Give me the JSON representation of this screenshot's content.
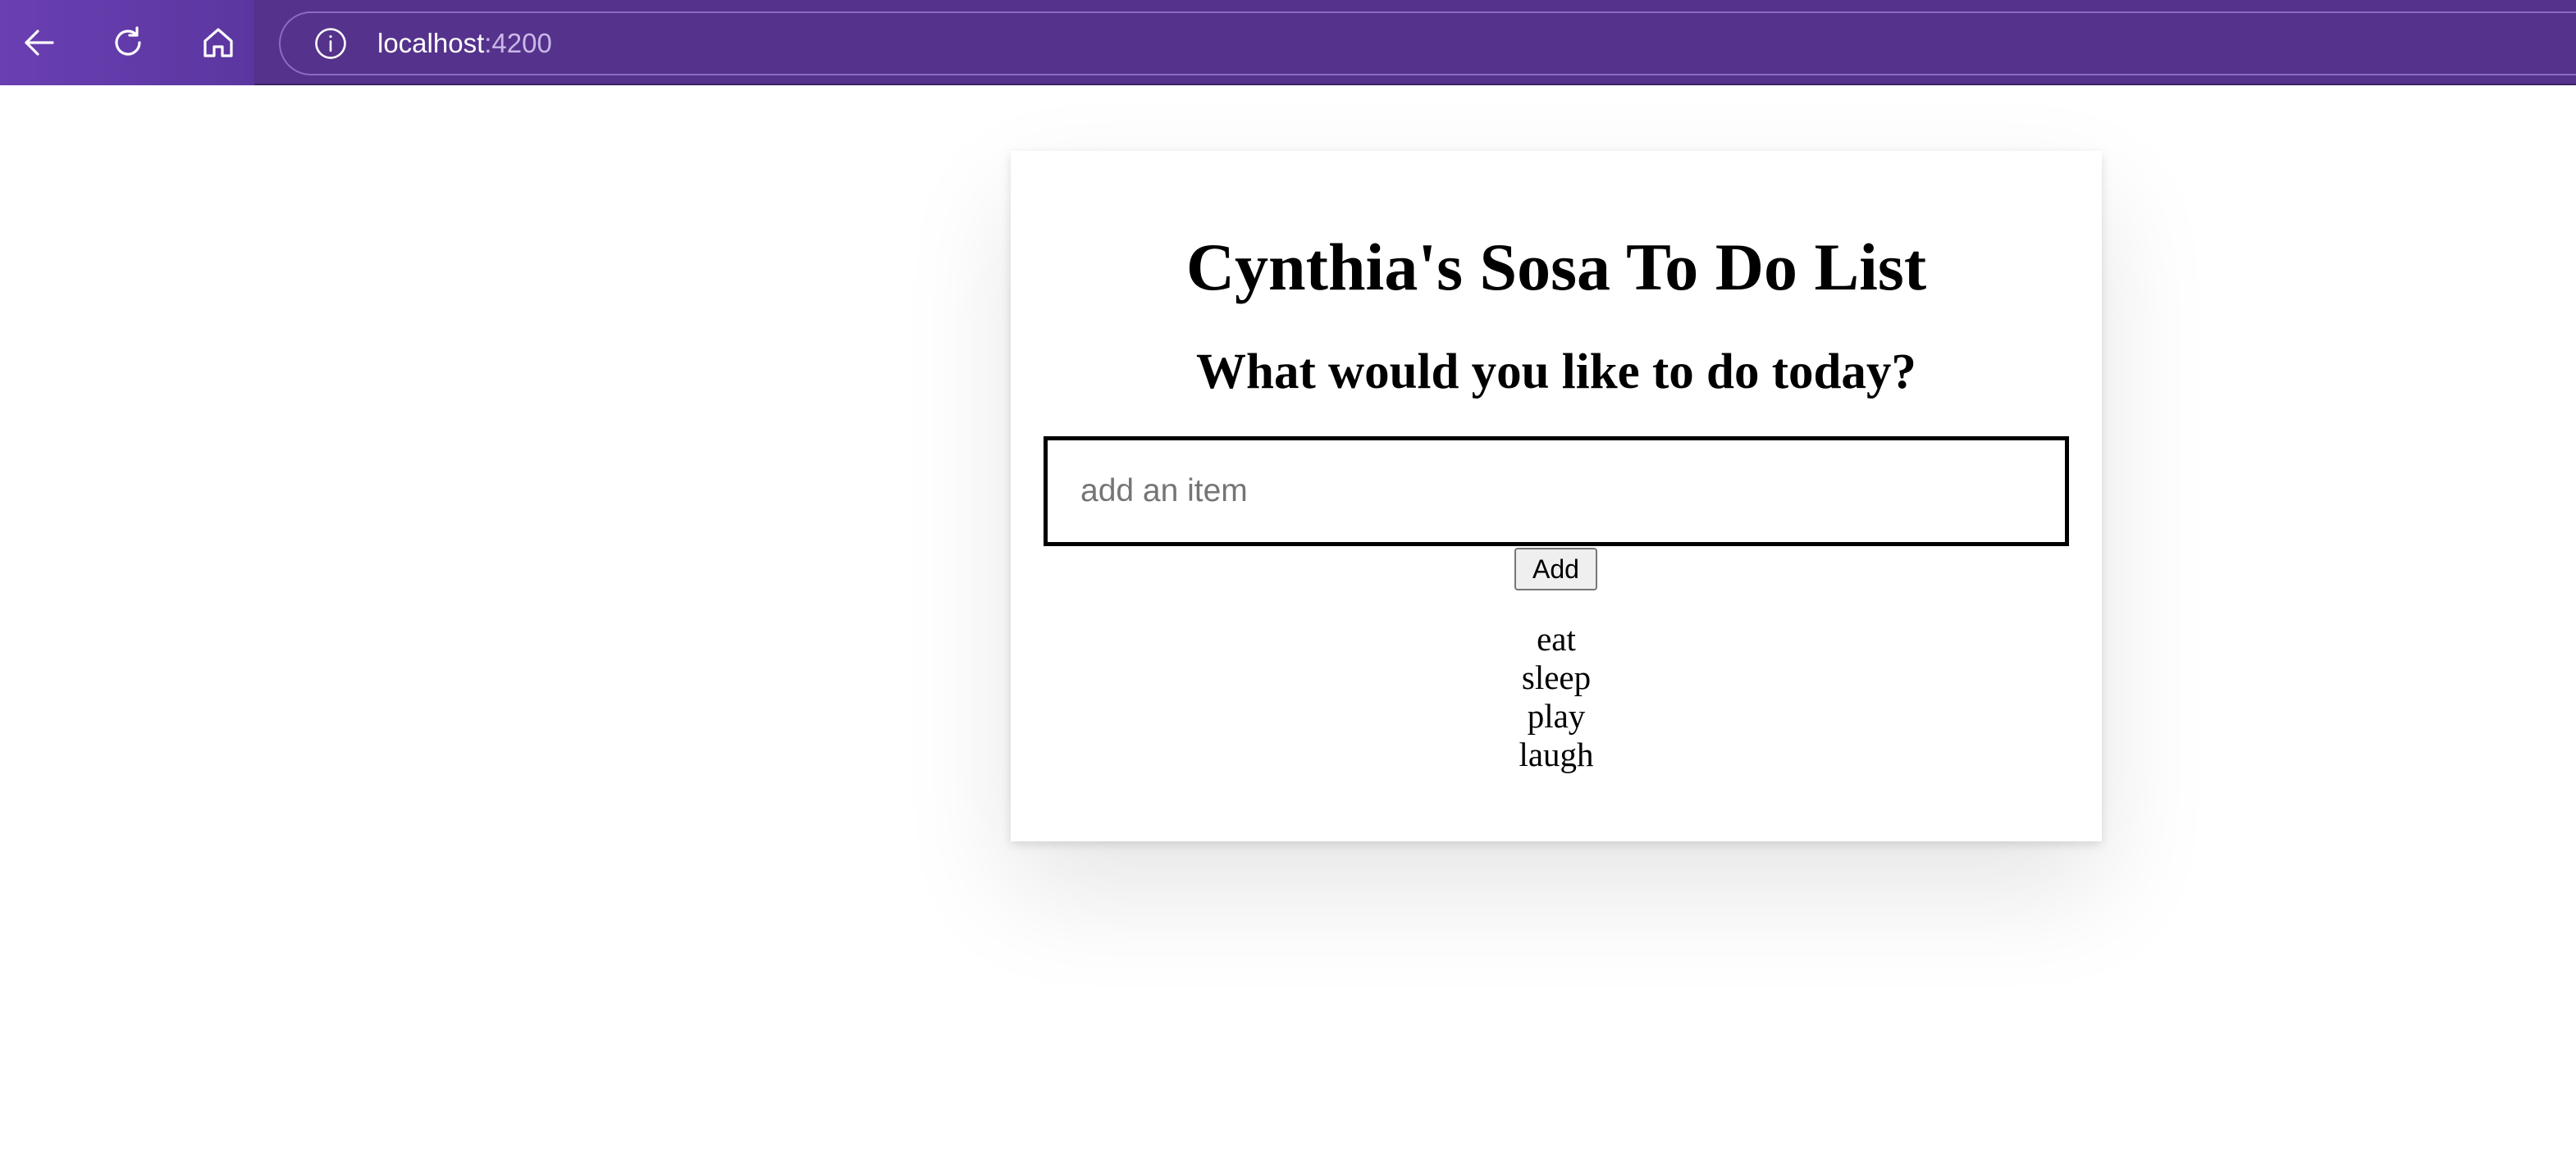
{
  "browser": {
    "url_host": "localhost",
    "url_port": ":4200",
    "icons": {
      "back": "arrow-left-icon",
      "refresh": "refresh-icon",
      "home": "home-icon",
      "site_info": "info-icon"
    },
    "colors": {
      "toolbar": "#55328b",
      "toolbar_left": "#6a3fb2"
    }
  },
  "page": {
    "title": "Cynthia's Sosa To Do List",
    "subtitle": "What would you like to do today?",
    "input": {
      "placeholder": "add an item",
      "value": ""
    },
    "add_button_label": "Add",
    "items": [
      "eat",
      "sleep",
      "play",
      "laugh"
    ]
  }
}
